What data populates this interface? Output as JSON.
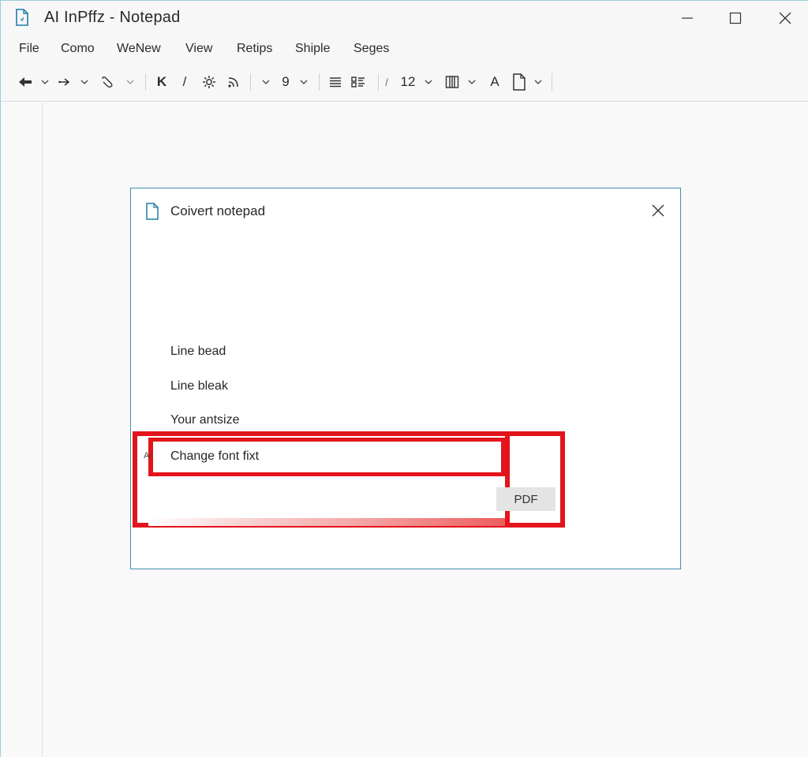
{
  "window": {
    "title": "AI InPffz - Notepad"
  },
  "menu": {
    "items": [
      "File",
      "Como",
      "WeNew",
      "View",
      "Retips",
      "Shiple",
      "Seges"
    ]
  },
  "toolbar": {
    "font_size_value": "9",
    "zoom_value": "12",
    "bold_label": "K",
    "italic_label": "/",
    "font_label": "A"
  },
  "dialog": {
    "title": "Coivert notepad",
    "options": [
      "Line bead",
      "Line bleak",
      "Your antsize",
      "Change font fixt"
    ],
    "small_mark": "A/",
    "pdf_button": "PDF"
  },
  "colors": {
    "accent": "#3e8fb0",
    "highlight": "#e3141b"
  }
}
